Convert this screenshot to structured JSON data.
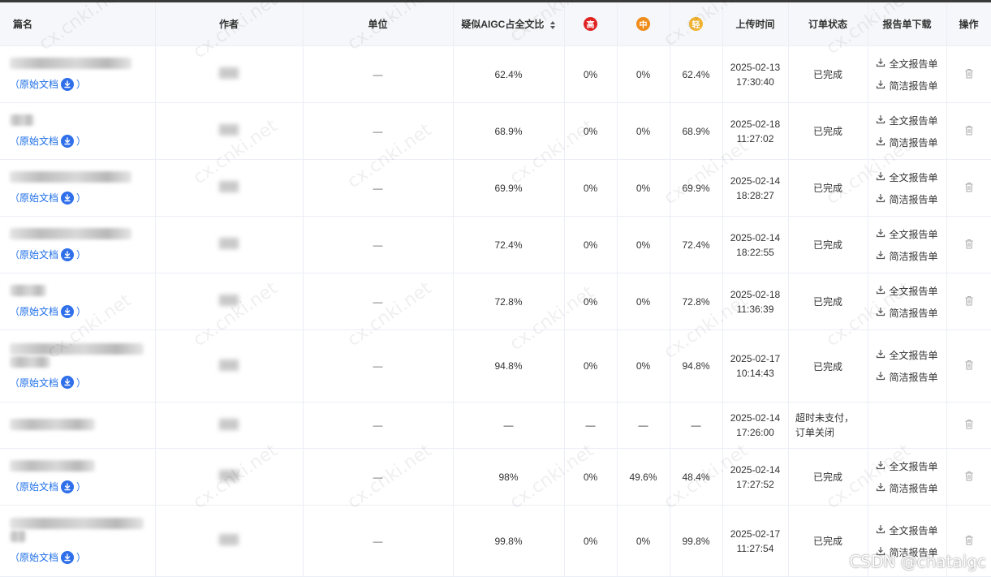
{
  "columns": {
    "name": "篇名",
    "author": "作者",
    "unit": "单位",
    "aigc": "疑似AIGC占全文比",
    "high": "高",
    "mid": "中",
    "low": "轻",
    "upload_time": "上传时间",
    "order_status": "订单状态",
    "download": "报告单下载",
    "action": "操作"
  },
  "colors": {
    "high": "#e02424",
    "mid": "#f08c1a",
    "low": "#f2b330",
    "link": "#1f6fe8"
  },
  "original_doc_label": "（原始文档",
  "original_doc_close": "）",
  "full_report_label": "全文报告单",
  "simple_report_label": "简洁报告单",
  "rows": [
    {
      "unit": "—",
      "aigc": "62.4%",
      "high": "0%",
      "mid": "0%",
      "low": "62.4%",
      "date": "2025-02-13",
      "time": "17:30:40",
      "status": "已完成",
      "has_doc": true,
      "has_reports": true
    },
    {
      "unit": "—",
      "aigc": "68.9%",
      "high": "0%",
      "mid": "0%",
      "low": "68.9%",
      "date": "2025-02-18",
      "time": "11:27:02",
      "status": "已完成",
      "has_doc": true,
      "has_reports": true
    },
    {
      "unit": "—",
      "aigc": "69.9%",
      "high": "0%",
      "mid": "0%",
      "low": "69.9%",
      "date": "2025-02-14",
      "time": "18:28:27",
      "status": "已完成",
      "has_doc": true,
      "has_reports": true
    },
    {
      "unit": "—",
      "aigc": "72.4%",
      "high": "0%",
      "mid": "0%",
      "low": "72.4%",
      "date": "2025-02-14",
      "time": "18:22:55",
      "status": "已完成",
      "has_doc": true,
      "has_reports": true
    },
    {
      "unit": "—",
      "aigc": "72.8%",
      "high": "0%",
      "mid": "0%",
      "low": "72.8%",
      "date": "2025-02-18",
      "time": "11:36:39",
      "status": "已完成",
      "has_doc": true,
      "has_reports": true
    },
    {
      "unit": "—",
      "aigc": "94.8%",
      "high": "0%",
      "mid": "0%",
      "low": "94.8%",
      "date": "2025-02-17",
      "time": "10:14:43",
      "status": "已完成",
      "has_doc": true,
      "has_reports": true
    },
    {
      "unit": "—",
      "aigc": "—",
      "high": "—",
      "mid": "—",
      "low": "—",
      "date": "2025-02-14",
      "time": "17:26:00",
      "status": "超时未支付，订单关闭",
      "has_doc": false,
      "has_reports": false
    },
    {
      "unit": "—",
      "aigc": "98%",
      "high": "0%",
      "mid": "49.6%",
      "low": "48.4%",
      "date": "2025-02-14",
      "time": "17:27:52",
      "status": "已完成",
      "has_doc": true,
      "has_reports": true
    },
    {
      "unit": "—",
      "aigc": "99.8%",
      "high": "0%",
      "mid": "0%",
      "low": "99.8%",
      "date": "2025-02-17",
      "time": "11:27:54",
      "status": "已完成",
      "has_doc": true,
      "has_reports": true
    }
  ],
  "watermark_text": "cx.cnki.net",
  "csdn_watermark": "CSDN @chataigc"
}
